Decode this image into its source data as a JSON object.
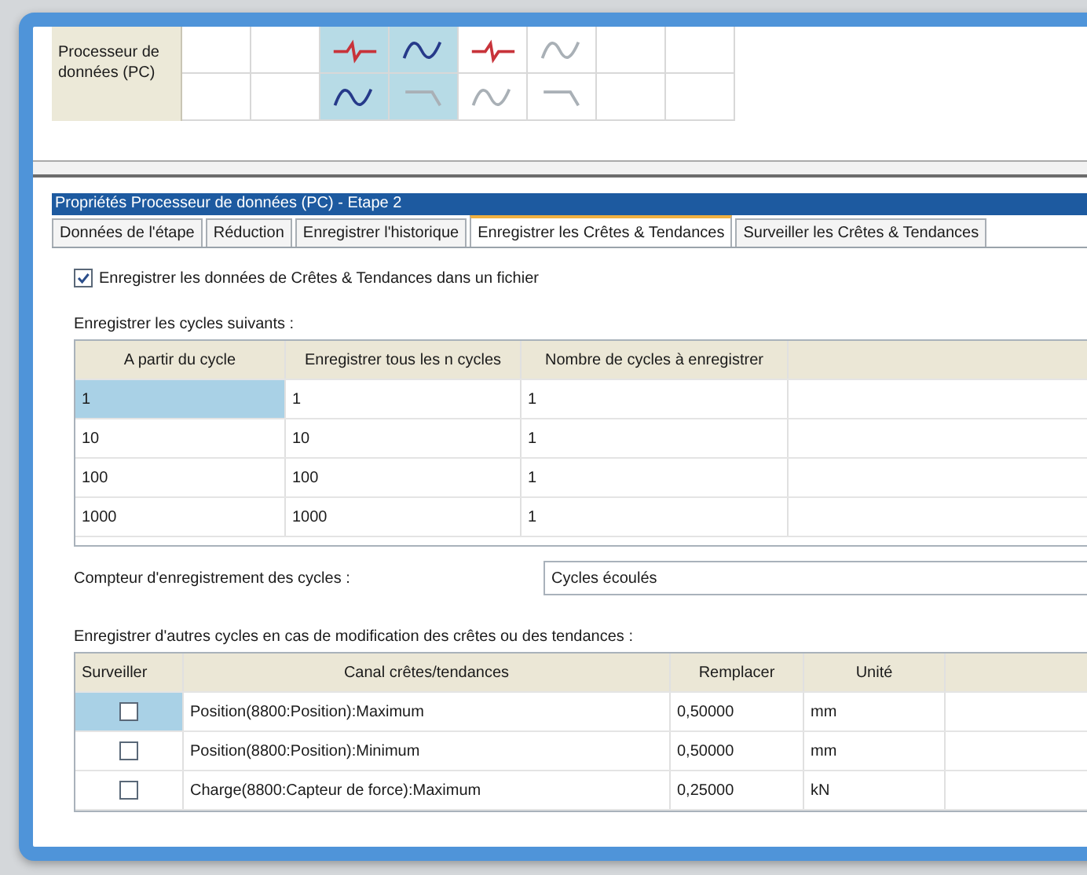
{
  "process_grid": {
    "label": "Processeur de données (PC)",
    "columns": [
      {
        "selected": true,
        "icons": [
          {
            "kind": "step",
            "dimmed": false
          },
          {
            "kind": "wave",
            "dimmed": false
          }
        ]
      },
      {
        "selected": true,
        "icons": [
          {
            "kind": "wave",
            "dimmed": false
          },
          {
            "kind": "ramp",
            "dimmed": true
          }
        ]
      },
      {
        "selected": false,
        "icons": [
          {
            "kind": "step",
            "dimmed": false
          },
          {
            "kind": "wave",
            "dimmed": true
          }
        ]
      },
      {
        "selected": false,
        "icons": [
          {
            "kind": "wave",
            "dimmed": true
          },
          {
            "kind": "ramp",
            "dimmed": true
          }
        ]
      }
    ]
  },
  "dialog": {
    "title": "Propriétés Processeur de données (PC) - Etape 2",
    "tabs": [
      {
        "label": "Données de l'étape",
        "selected": false
      },
      {
        "label": "Réduction",
        "selected": false
      },
      {
        "label": "Enregistrer l'historique",
        "selected": false
      },
      {
        "label": "Enregistrer les Crêtes & Tendances",
        "selected": true
      },
      {
        "label": "Surveiller les Crêtes & Tendances",
        "selected": false
      }
    ],
    "save_checkbox": {
      "label": "Enregistrer les données de Crêtes & Tendances dans un fichier",
      "checked": true
    },
    "cycles": {
      "label": "Enregistrer les cycles suivants :",
      "columns": [
        "A partir du cycle",
        "Enregistrer tous les n cycles",
        "Nombre de cycles à enregistrer"
      ],
      "rows": [
        {
          "cells": [
            "1",
            "1",
            "1"
          ],
          "selected": true
        },
        {
          "cells": [
            "10",
            "10",
            "1"
          ],
          "selected": false
        },
        {
          "cells": [
            "100",
            "100",
            "1"
          ],
          "selected": false
        },
        {
          "cells": [
            "1000",
            "1000",
            "1"
          ],
          "selected": false
        }
      ]
    },
    "counter": {
      "label": "Compteur d'enregistrement des cycles :",
      "value": "Cycles écoulés"
    },
    "other": {
      "label": "Enregistrer d'autres cycles en cas de modification des crêtes ou des tendances :",
      "columns": [
        "Surveiller",
        "Canal crêtes/tendances",
        "Remplacer",
        "Unité"
      ],
      "rows": [
        {
          "checked": false,
          "selected": true,
          "channel": "Position(8800:Position):Maximum",
          "value": "0,50000",
          "unit": "mm"
        },
        {
          "checked": false,
          "selected": false,
          "channel": "Position(8800:Position):Minimum",
          "value": "0,50000",
          "unit": "mm"
        },
        {
          "checked": false,
          "selected": false,
          "channel": "Charge(8800:Capteur de force):Maximum",
          "value": "0,25000",
          "unit": "kN"
        }
      ]
    }
  }
}
